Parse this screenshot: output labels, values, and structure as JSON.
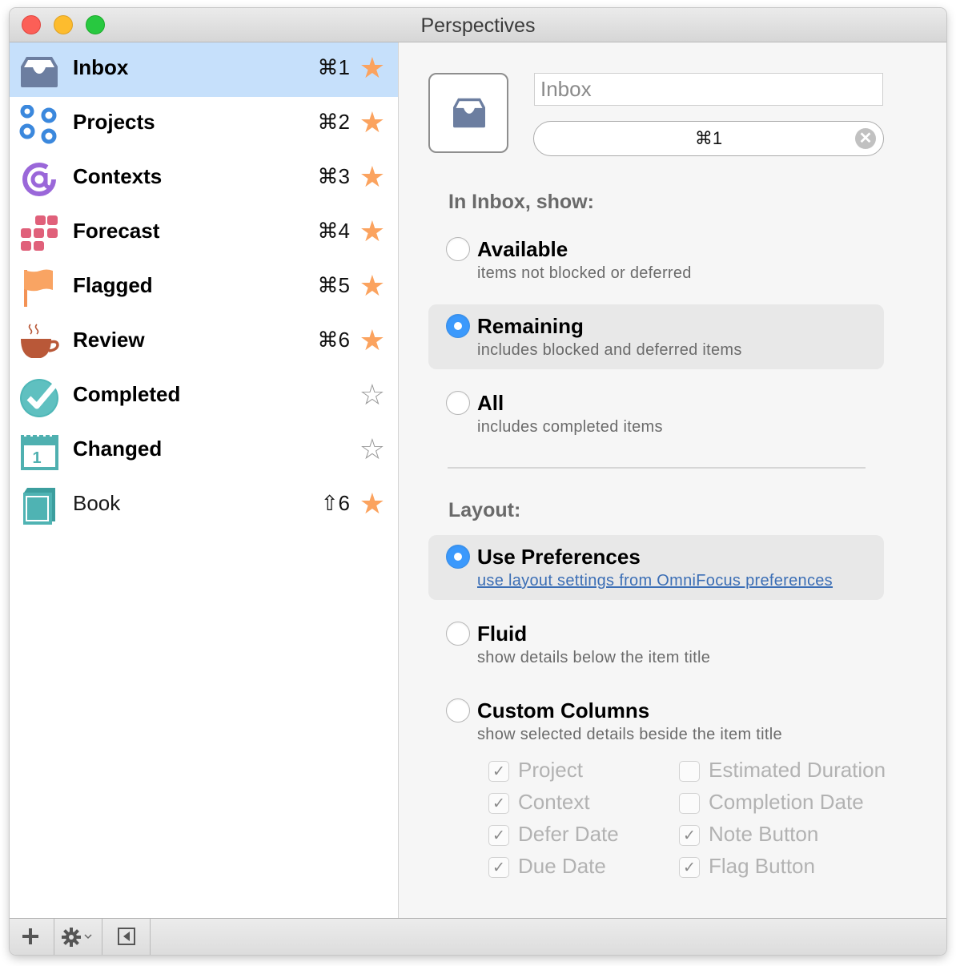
{
  "window": {
    "title": "Perspectives"
  },
  "sidebar": {
    "items": [
      {
        "label": "Inbox",
        "shortcut": "⌘1",
        "favorite": true,
        "selected": true,
        "bold": true,
        "icon": "inbox-icon"
      },
      {
        "label": "Projects",
        "shortcut": "⌘2",
        "favorite": true,
        "selected": false,
        "bold": true,
        "icon": "projects-icon"
      },
      {
        "label": "Contexts",
        "shortcut": "⌘3",
        "favorite": true,
        "selected": false,
        "bold": true,
        "icon": "contexts-at-icon"
      },
      {
        "label": "Forecast",
        "shortcut": "⌘4",
        "favorite": true,
        "selected": false,
        "bold": true,
        "icon": "forecast-icon"
      },
      {
        "label": "Flagged",
        "shortcut": "⌘5",
        "favorite": true,
        "selected": false,
        "bold": true,
        "icon": "flag-icon"
      },
      {
        "label": "Review",
        "shortcut": "⌘6",
        "favorite": true,
        "selected": false,
        "bold": true,
        "icon": "coffee-cup-icon"
      },
      {
        "label": "Completed",
        "shortcut": "",
        "favorite": false,
        "selected": false,
        "bold": true,
        "icon": "checkmark-circle-icon"
      },
      {
        "label": "Changed",
        "shortcut": "",
        "favorite": false,
        "selected": false,
        "bold": true,
        "icon": "calendar-icon"
      },
      {
        "label": "Book",
        "shortcut": "⇧6",
        "favorite": true,
        "selected": false,
        "bold": false,
        "icon": "book-icon"
      }
    ],
    "star_filled": "★",
    "star_empty": "☆"
  },
  "toolbar": {
    "add_label": "+",
    "gear_label": "⚙",
    "gear_chevron": "⌄",
    "sidebar_toggle_label": "◀"
  },
  "detail": {
    "name_value": "Inbox",
    "shortcut_value": "⌘1",
    "clear_label": "✕",
    "show_heading": "In Inbox, show:",
    "show_options": [
      {
        "title": "Available",
        "desc": "items not blocked or deferred",
        "selected": false
      },
      {
        "title": "Remaining",
        "desc": "includes blocked and deferred items",
        "selected": true
      },
      {
        "title": "All",
        "desc": "includes completed items",
        "selected": false
      }
    ],
    "layout_heading": "Layout:",
    "layout_options": [
      {
        "title": "Use Preferences",
        "desc": "use layout settings from OmniFocus preferences",
        "selected": true,
        "link": true
      },
      {
        "title": "Fluid",
        "desc": "show details below the item title",
        "selected": false
      },
      {
        "title": "Custom Columns",
        "desc": "show selected details beside the item title",
        "selected": false
      }
    ],
    "columns": [
      {
        "label": "Project",
        "checked": true
      },
      {
        "label": "Context",
        "checked": true
      },
      {
        "label": "Defer Date",
        "checked": true
      },
      {
        "label": "Due Date",
        "checked": true
      },
      {
        "label": "Estimated Duration",
        "checked": false
      },
      {
        "label": "Completion Date",
        "checked": false
      },
      {
        "label": "Note Button",
        "checked": true
      },
      {
        "label": "Flag Button",
        "checked": true
      }
    ],
    "check_glyph": "✓"
  },
  "colors": {
    "selection": "#c6e0fb",
    "star": "#fba35f",
    "radio_accent": "#3b99fc",
    "link": "#3b6eb5"
  }
}
